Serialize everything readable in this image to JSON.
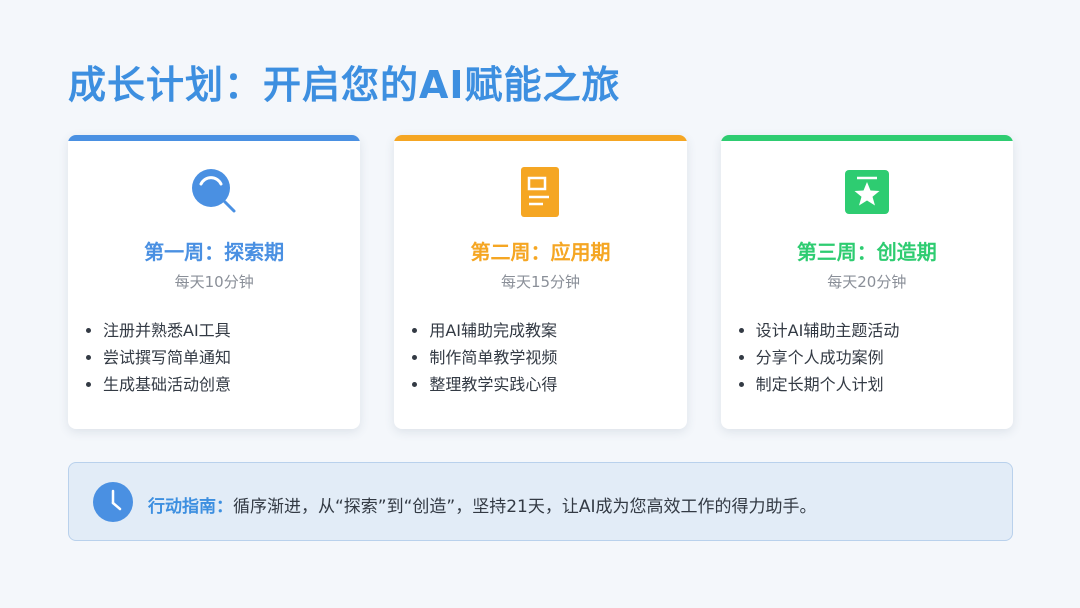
{
  "title": "成长计划：开启您的AI赋能之旅",
  "colors": {
    "blue": "#4a90e2",
    "orange": "#f5a623",
    "green": "#2ecc71"
  },
  "cards": [
    {
      "icon": "magnifier-icon",
      "week": "第一周：探索期",
      "daily": "每天10分钟",
      "items": [
        "注册并熟悉AI工具",
        "尝试撰写简单通知",
        "生成基础活动创意"
      ]
    },
    {
      "icon": "document-icon",
      "week": "第二周：应用期",
      "daily": "每天15分钟",
      "items": [
        "用AI辅助完成教案",
        "制作简单教学视频",
        "整理教学实践心得"
      ]
    },
    {
      "icon": "star-badge-icon",
      "week": "第三周：创造期",
      "daily": "每天20分钟",
      "items": [
        "设计AI辅助主题活动",
        "分享个人成功案例",
        "制定长期个人计划"
      ]
    }
  ],
  "guide": {
    "icon": "clock-icon",
    "label": "行动指南：",
    "text": "循序渐进，从“探索”到“创造”，坚持21天，让AI成为您高效工作的得力助手。"
  }
}
